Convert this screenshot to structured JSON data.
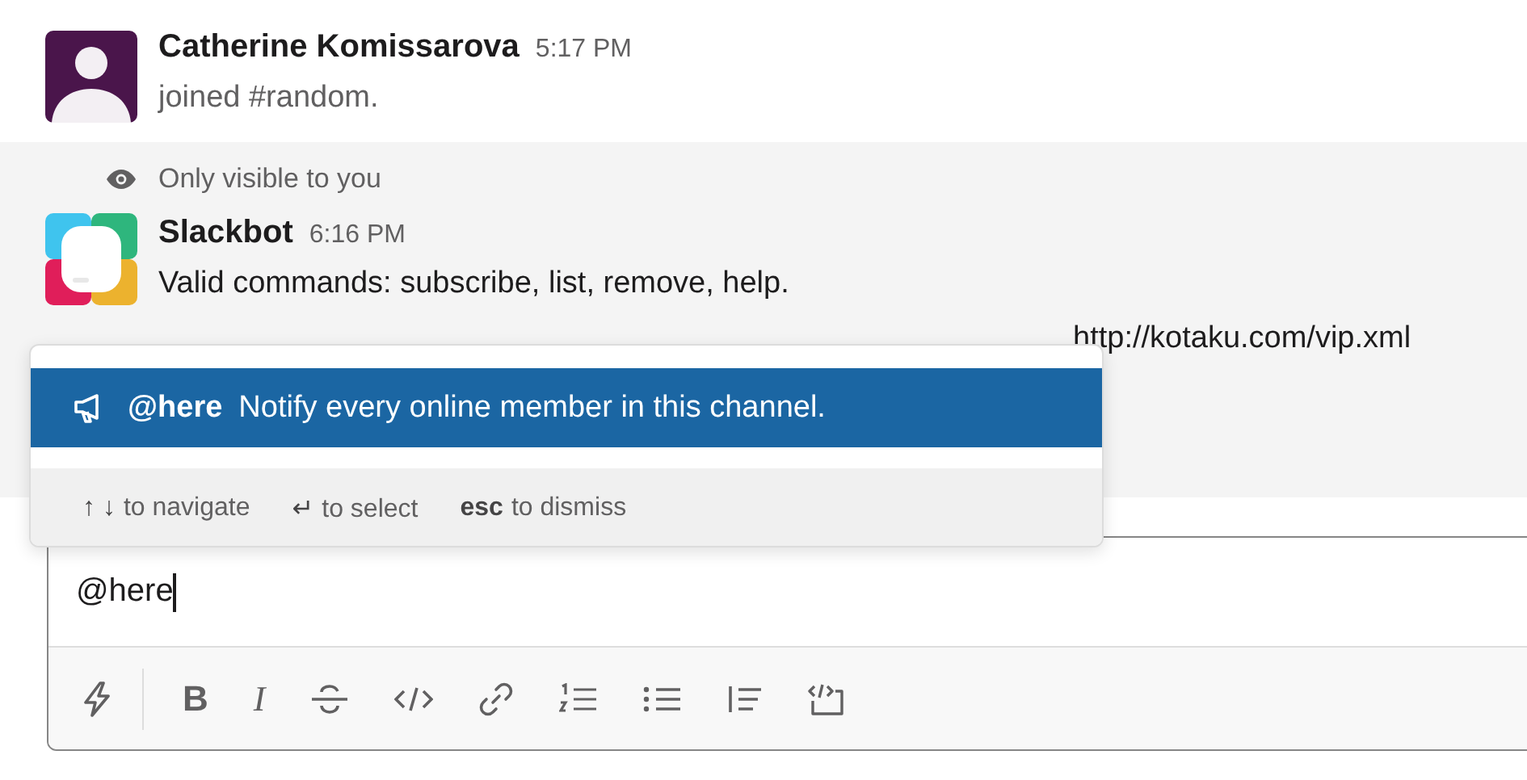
{
  "messages": [
    {
      "kind": "user",
      "author": "Catherine Komissarova",
      "time": "5:17 PM",
      "lines": [
        "joined #random."
      ]
    },
    {
      "kind": "bot",
      "visibility_note": "Only visible to you",
      "author": "Slackbot",
      "time": "6:16 PM",
      "lines": [
        "Valid commands: subscribe, list, remove, help."
      ],
      "partly_covered_line": "http://kotaku.com/vip.xml"
    }
  ],
  "autocomplete": {
    "items": [
      {
        "mention": "@here",
        "description": "Notify every online member in this channel.",
        "selected": true
      }
    ],
    "hints": [
      {
        "keys": "↑ ↓",
        "text": "to navigate"
      },
      {
        "keys": "↵",
        "text": "to select"
      },
      {
        "keys": "esc",
        "text": "to dismiss"
      }
    ]
  },
  "composer": {
    "value": "@here",
    "toolbar": [
      {
        "kind": "shortcuts"
      },
      {
        "kind": "bold",
        "glyph": "B"
      },
      {
        "kind": "italic",
        "glyph": "I"
      },
      {
        "kind": "strike"
      },
      {
        "kind": "code"
      },
      {
        "kind": "link"
      },
      {
        "kind": "ordered-list"
      },
      {
        "kind": "bulleted-list"
      },
      {
        "kind": "quote"
      },
      {
        "kind": "code-block"
      }
    ]
  }
}
